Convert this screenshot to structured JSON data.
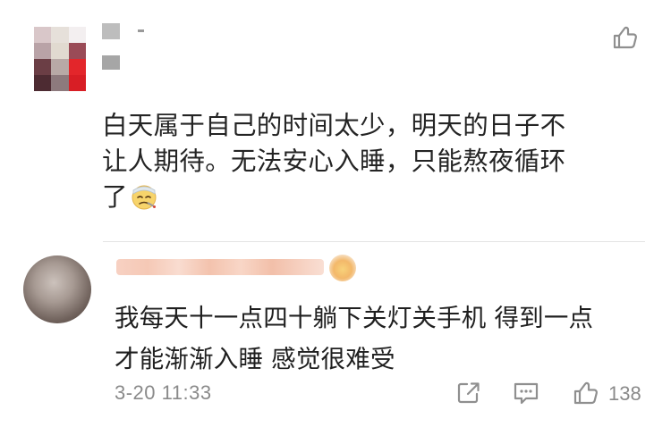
{
  "post": {
    "text_lines": [
      "白天属于自己的时间太少，明天的日子不",
      "让人期待。无法安心入睡，只能熬夜循环",
      "了"
    ],
    "emoji": "sick-face-emoji"
  },
  "reply": {
    "text_lines": [
      "我每天十一点四十躺下关灯关手机 得到一点",
      "才能渐渐入睡 感觉很难受"
    ],
    "time": "3-20 11:33",
    "like_count": "138"
  },
  "icons": {
    "like": "thumbs-up-icon",
    "share": "share-icon",
    "comment": "comment-icon"
  },
  "colors": {
    "text": "#242424",
    "meta": "#8a8a8a",
    "divider": "#e4e4e4"
  }
}
